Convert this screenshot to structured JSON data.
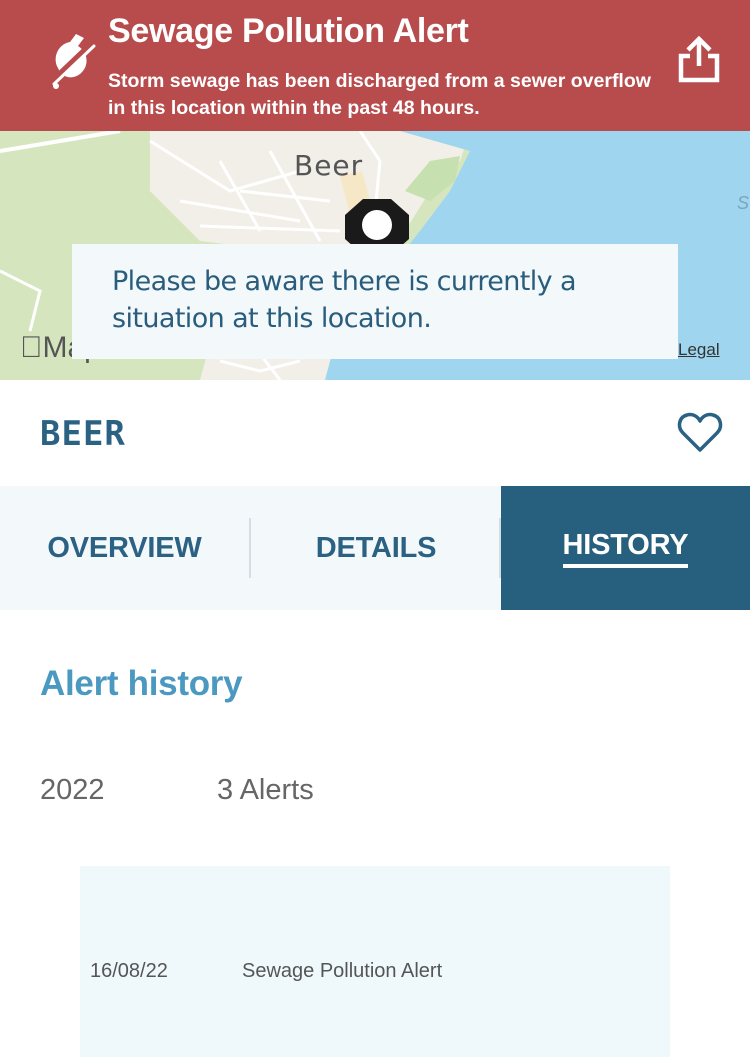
{
  "alert": {
    "title": "Sewage Pollution Alert",
    "message": "Storm sewage has been discharged from a sewer overflow in this location within the past 48 hours.",
    "icon": "no-swim-icon",
    "share_icon": "share-icon",
    "color": "#b84b4c"
  },
  "map": {
    "town_label": "Beer",
    "edge_label": "S",
    "logo_text": "Map",
    "legal_label": "Legal",
    "notice": "Please be aware there is currently a situation at this location."
  },
  "location": {
    "title": "BEER",
    "favorite_icon": "heart-outline-icon"
  },
  "tabs": [
    {
      "label": "OVERVIEW",
      "active": false
    },
    {
      "label": "DETAILS",
      "active": false
    },
    {
      "label": "HISTORY",
      "active": true
    }
  ],
  "history": {
    "title": "Alert history",
    "years": [
      {
        "year": "2022",
        "count_label": "3 Alerts",
        "alerts": [
          {
            "date": "16/08/22",
            "type": "Sewage Pollution Alert"
          }
        ]
      }
    ]
  },
  "colors": {
    "primary": "#275f7e",
    "accent": "#4b99c1",
    "tab_bg": "#f3f8fb",
    "card_bg": "#eff9fc"
  }
}
